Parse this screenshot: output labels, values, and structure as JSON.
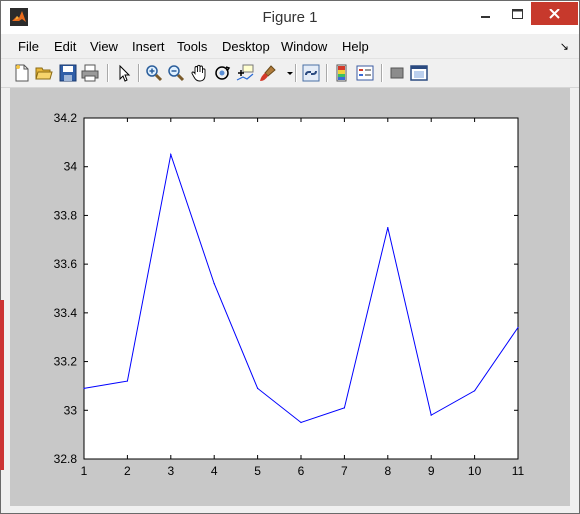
{
  "window": {
    "title": "Figure 1"
  },
  "menu": [
    "File",
    "Edit",
    "View",
    "Insert",
    "Tools",
    "Desktop",
    "Window",
    "Help"
  ],
  "toolbar": {
    "buttons": [
      "new-figure-icon",
      "open-file-icon",
      "save-icon",
      "print-icon",
      "edit-plot-arrow-icon",
      "zoom-in-icon",
      "zoom-out-icon",
      "pan-hand-icon",
      "rotate-3d-icon",
      "data-cursor-icon",
      "brush-icon",
      "brush-dropdown-icon",
      "link-plot-icon",
      "colorbar-icon",
      "legend-icon",
      "hide-plot-tools-icon",
      "show-plot-tools-icon"
    ]
  },
  "colors": {
    "line": "#0000ff",
    "figure_bg": "#c8c8c8",
    "axes_bg": "#ffffff",
    "close_button": "#c7392c"
  },
  "chart_data": {
    "type": "line",
    "x": [
      1,
      2,
      3,
      4,
      5,
      6,
      7,
      8,
      9,
      10,
      11
    ],
    "series": [
      {
        "values": [
          33.09,
          33.12,
          34.05,
          33.52,
          33.09,
          32.95,
          33.01,
          33.75,
          32.98,
          33.08,
          33.34
        ]
      }
    ],
    "xlim": [
      1,
      11
    ],
    "ylim": [
      32.8,
      34.2
    ],
    "xticks": [
      "1",
      "2",
      "3",
      "4",
      "5",
      "6",
      "7",
      "8",
      "9",
      "10",
      "11"
    ],
    "yticks": [
      "32.8",
      "33",
      "33.2",
      "33.4",
      "33.6",
      "33.8",
      "34",
      "34.2"
    ],
    "grid": false
  }
}
